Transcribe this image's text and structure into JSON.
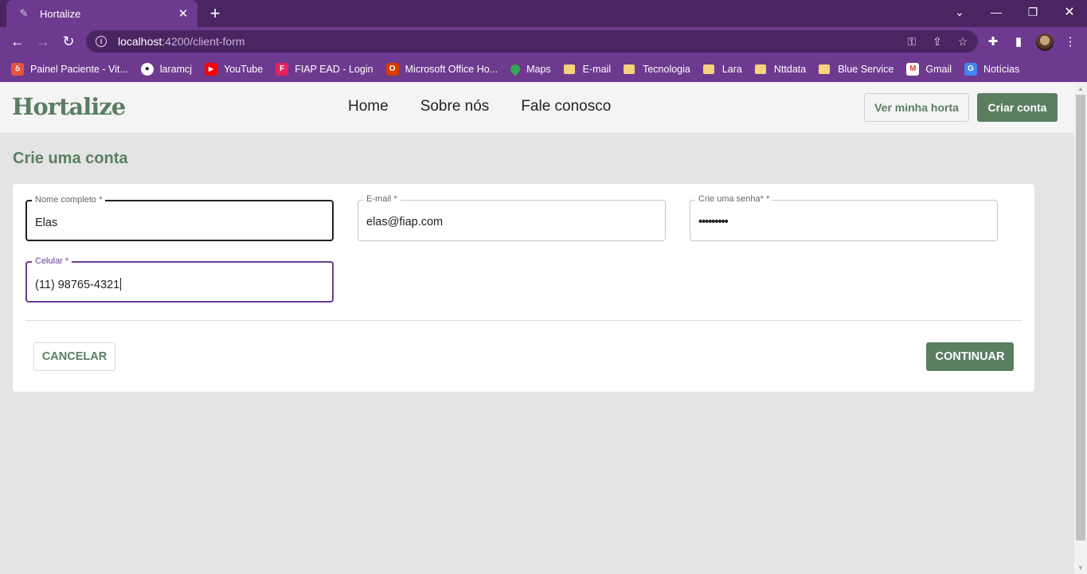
{
  "browser": {
    "tab_title": "Hortalize",
    "url_host": "localhost",
    "url_path": ":4200/client-form",
    "bookmarks": [
      {
        "label": "Painel Paciente - Vit...",
        "icon": "painel-icon",
        "color": "#e8543f"
      },
      {
        "label": "laramcj",
        "icon": "github-icon",
        "color": "#222222"
      },
      {
        "label": "YouTube",
        "icon": "youtube-icon",
        "color": "#ff0000"
      },
      {
        "label": "FIAP EAD - Login",
        "icon": "fiap-icon",
        "color": "#e4235d"
      },
      {
        "label": "Microsoft Office Ho...",
        "icon": "office-icon",
        "color": "#d83b01"
      },
      {
        "label": "Maps",
        "icon": "maps-icon",
        "color": "#34a853"
      },
      {
        "label": "E-mail",
        "icon": "folder-icon",
        "color": "#f6d37a"
      },
      {
        "label": "Tecnologia",
        "icon": "folder-icon",
        "color": "#f6d37a"
      },
      {
        "label": "Lara",
        "icon": "folder-icon",
        "color": "#f6d37a"
      },
      {
        "label": "Nttdata",
        "icon": "folder-icon",
        "color": "#f6d37a"
      },
      {
        "label": "Blue Service",
        "icon": "folder-icon",
        "color": "#f6d37a"
      },
      {
        "label": "Gmail",
        "icon": "gmail-icon",
        "color": "#ea4335"
      },
      {
        "label": "Notícias",
        "icon": "news-icon",
        "color": "#4285f4"
      }
    ]
  },
  "header": {
    "logo": "Hortalize",
    "nav": [
      "Home",
      "Sobre nós",
      "Fale conosco"
    ],
    "view_garden_label": "Ver minha horta",
    "create_account_label": "Criar conta"
  },
  "main": {
    "title": "Crie uma conta",
    "fields": {
      "name": {
        "label": "Nome completo *",
        "value": "Elas"
      },
      "email": {
        "label": "E-mail *",
        "value": "elas@fiap.com"
      },
      "password": {
        "label": "Crie uma senha* *",
        "value": "•••••••••"
      },
      "phone": {
        "label": "Celular *",
        "value": "(11) 98765-4321"
      }
    },
    "cancel_label": "CANCELAR",
    "continue_label": "CONTINUAR"
  },
  "colors": {
    "brand_green": "#5b7e61",
    "browser_purple": "#6d3a8f",
    "focus_purple": "#6a3b98"
  }
}
